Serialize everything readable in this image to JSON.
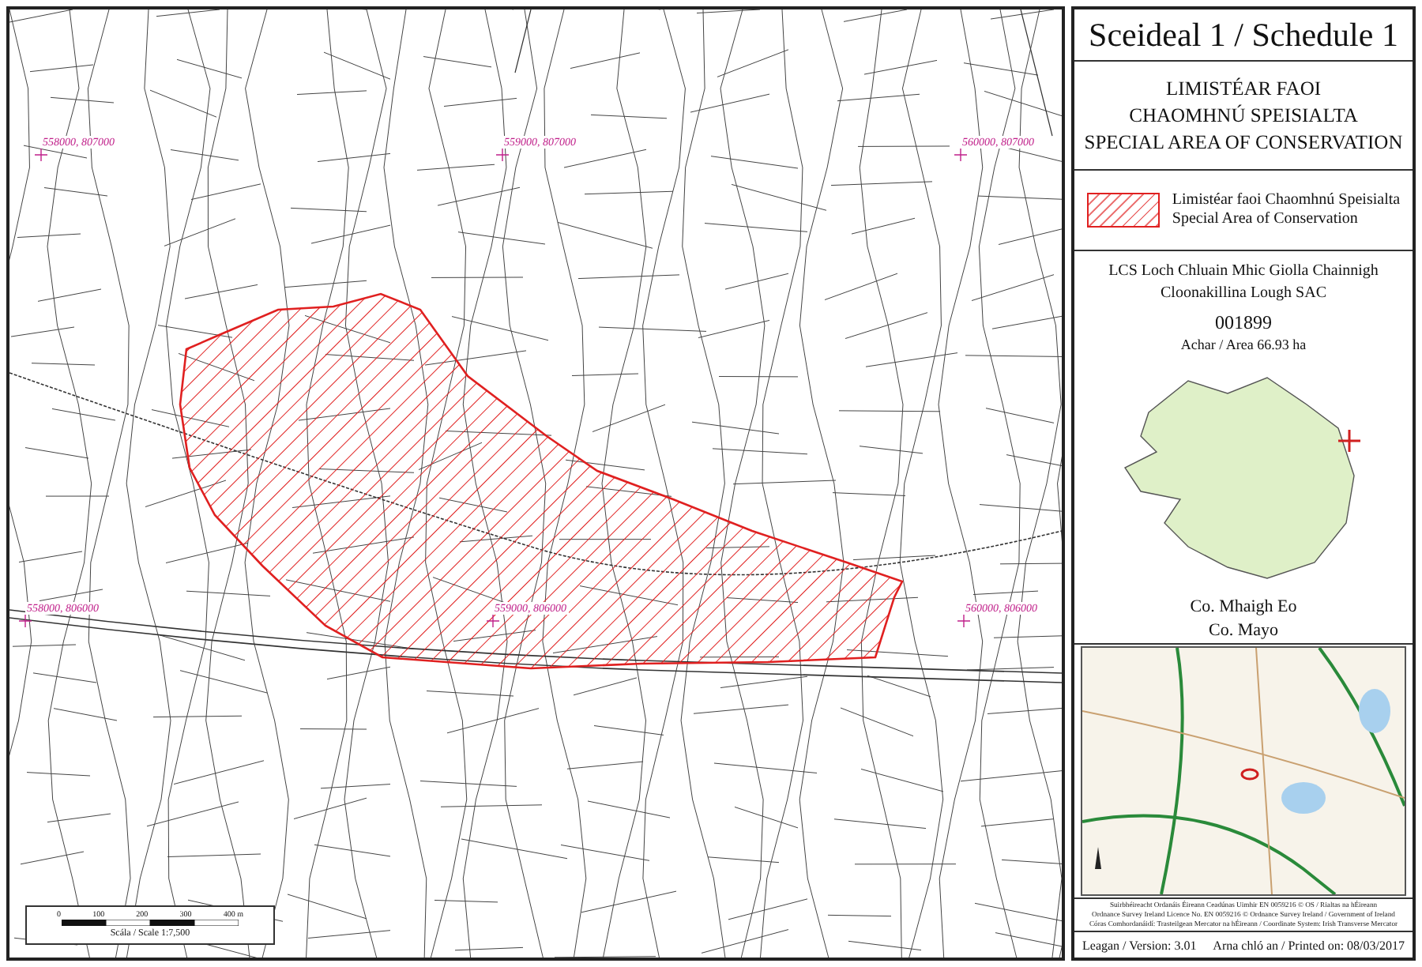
{
  "title": "Sceideal 1 / Schedule 1",
  "heading": [
    "LIMISTÉAR FAOI",
    "CHAOMHNÚ SPEISIALTA",
    "SPECIAL AREA OF CONSERVATION"
  ],
  "legend": {
    "lines": [
      "Limistéar faoi Chaomhnú Speisialta",
      "Special Area of Conservation"
    ],
    "color": "#e02020"
  },
  "site": {
    "name_ga": "LCS Loch Chluain Mhic Giolla Chainnigh",
    "name_en": "Cloonakillina Lough SAC",
    "code": "001899",
    "area": "Achar / Area 66.93 ha"
  },
  "county": [
    "Co. Mhaigh Eo",
    "Co. Mayo"
  ],
  "credits": [
    "Suirbhéireacht Ordanáis Éireann Ceadúnas Uimhir EN 0059216 © OS / Rialtas na hÉireann",
    "Ordnance Survey Ireland Licence No. EN 0059216 © Ordnance Survey Ireland / Government of Ireland",
    "Córas Comhordanáidí: Trasteilgean Mercator na hÉireann / Coordinate System: Irish Transverse Mercator"
  ],
  "version": "Leagan / Version: 3.01",
  "printed": "Arna chló an / Printed on: 08/03/2017",
  "map": {
    "grid_labels": [
      "558000, 807000",
      "559000, 807000",
      "560000, 807000",
      "558000, 806000",
      "559000, 806000",
      "560000, 806000"
    ],
    "scale_bar": {
      "ticks": [
        "0",
        "100",
        "200",
        "300",
        "400 m"
      ],
      "caption": "Scála / Scale 1:7,500"
    }
  }
}
